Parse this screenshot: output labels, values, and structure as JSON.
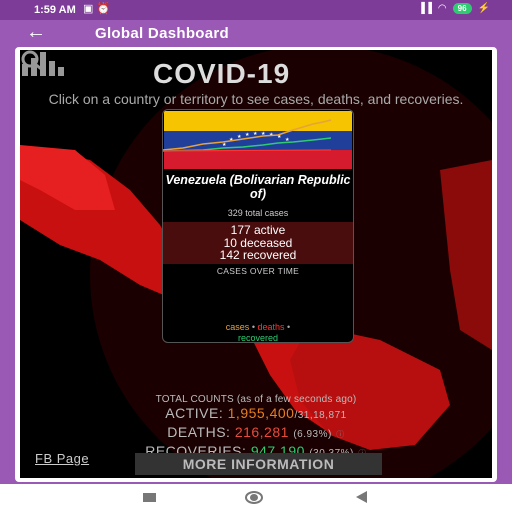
{
  "status_bar": {
    "time": "1:59 AM",
    "battery": "96"
  },
  "app_bar": {
    "title": "Global Dashboard"
  },
  "map": {
    "brand": "COVID-19",
    "subtitle": "Click on a country or territory to see cases, deaths, and recoveries."
  },
  "popup": {
    "country": "Venezuela (Bolivarian Republic of)",
    "total": "329 total cases",
    "active": "177 active",
    "deceased": "10 deceased",
    "recovered": "142 recovered",
    "chart_title": "CASES OVER TIME",
    "legend_cases": "cases",
    "legend_deaths": "deaths",
    "legend_recovered": "recovered",
    "colors": {
      "cases": "#e6a23c",
      "deaths": "#ff3333",
      "recovered": "#2ecc71"
    }
  },
  "totals": {
    "header": "TOTAL COUNTS (as of a few seconds ago)",
    "active_label": "ACTIVE:",
    "active_value": "1,955,400",
    "active_total": "/31,18,871",
    "deaths_label": "DEATHS:",
    "deaths_value": "216,281",
    "deaths_pct": "(6.93%)",
    "recoveries_label": "RECOVERIES:",
    "recoveries_value": "947,190",
    "recoveries_pct": "(30.37%)"
  },
  "footer": {
    "fb_page": "FB Page",
    "more_info": "MORE INFORMATION"
  }
}
